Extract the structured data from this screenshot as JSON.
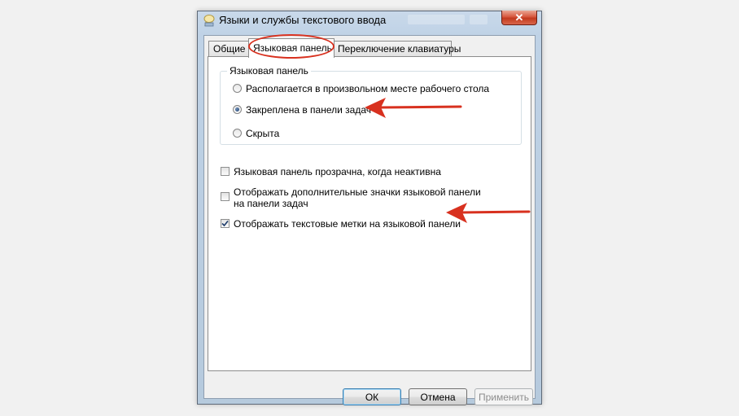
{
  "window": {
    "title": "Языки и службы текстового ввода",
    "close_glyph": "✕"
  },
  "tabs": [
    {
      "label": "Общие"
    },
    {
      "label": "Языковая панель"
    },
    {
      "label": "Переключение клавиатуры"
    }
  ],
  "active_tab": "Языковая панель",
  "language_bar_group": {
    "legend": "Языковая панель",
    "options": [
      {
        "label": "Располагается в произвольном месте рабочего стола",
        "selected": false
      },
      {
        "label": "Закреплена в панели задач",
        "selected": true
      },
      {
        "label": "Скрыта",
        "selected": false
      }
    ]
  },
  "checkboxes": [
    {
      "label": "Языковая панель прозрачна, когда неактивна",
      "checked": false
    },
    {
      "label": "Отображать дополнительные значки языковой панели на панели задач",
      "checked": false
    },
    {
      "label": "Отображать текстовые метки на языковой панели",
      "checked": true
    }
  ],
  "buttons": {
    "ok": "ОК",
    "cancel": "Отмена",
    "apply": "Применить"
  },
  "colors": {
    "annotation_red": "#d8311f",
    "close_button": "#c23a1e"
  },
  "icons": {
    "title": "keyboard-language-icon",
    "close": "close-icon"
  }
}
